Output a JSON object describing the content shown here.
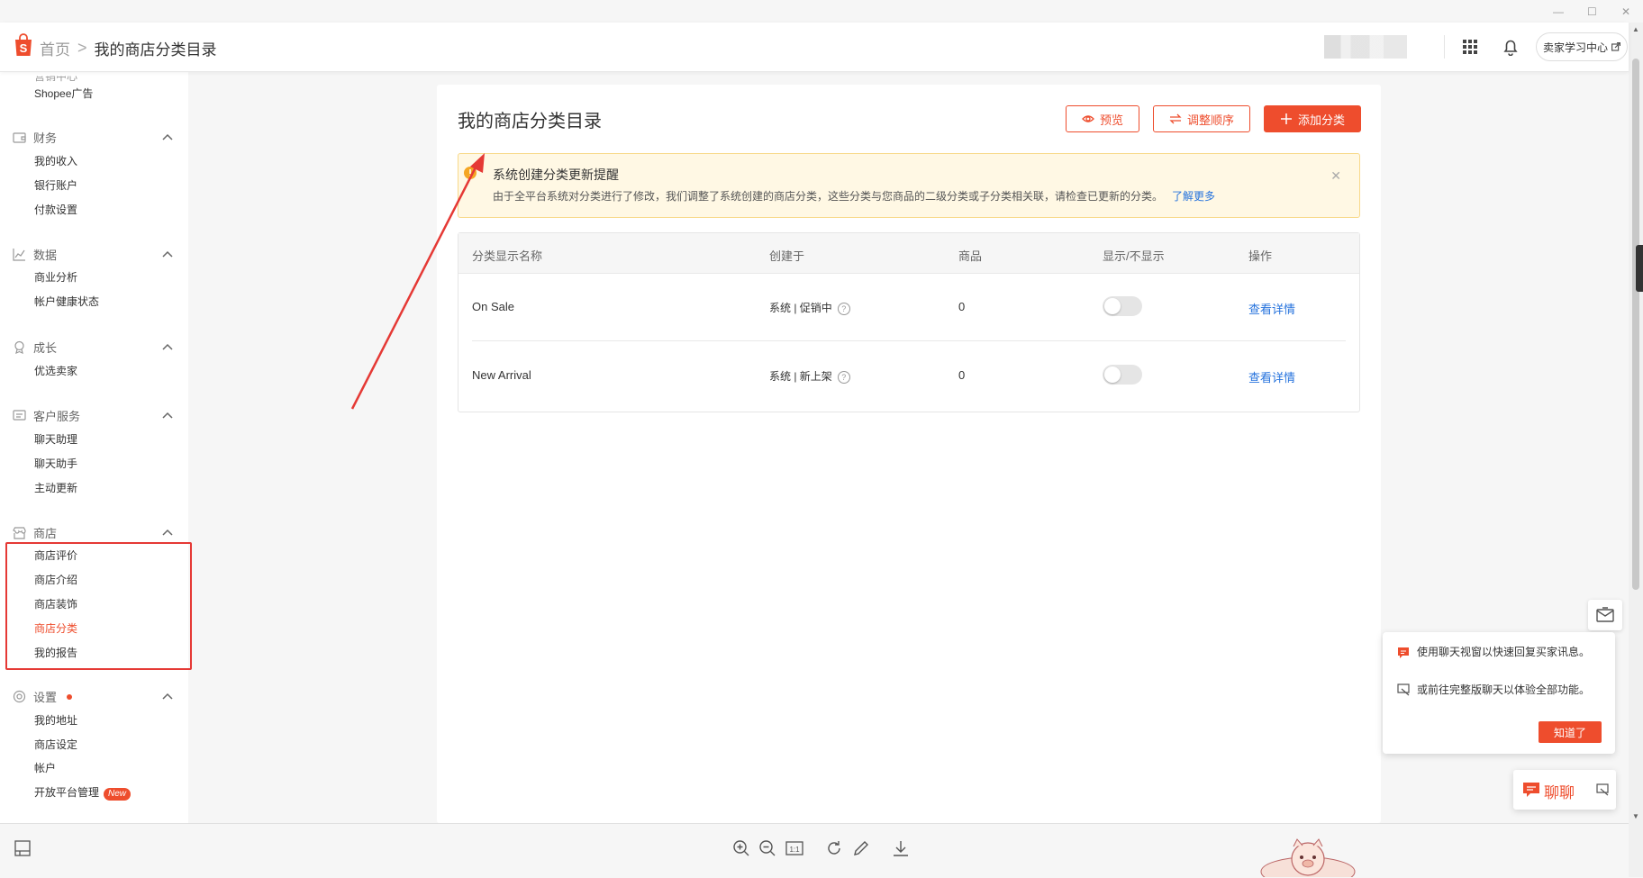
{
  "header": {
    "home_label": "首页",
    "separator": ">",
    "current_label": "我的商店分类目录",
    "learning_center": "卖家学习中心"
  },
  "window": {
    "minimize": "—",
    "maximize": "☐",
    "close": "✕"
  },
  "sidebar": {
    "partial_top": "营销中心",
    "ads": "Shopee广告",
    "sections": [
      {
        "title": "财务",
        "items": [
          "我的收入",
          "银行账户",
          "付款设置"
        ]
      },
      {
        "title": "数据",
        "items": [
          "商业分析",
          "帐户健康状态"
        ]
      },
      {
        "title": "成长",
        "items": [
          "优选卖家"
        ]
      },
      {
        "title": "客户服务",
        "items": [
          "聊天助理",
          "聊天助手",
          "主动更新"
        ]
      },
      {
        "title": "商店",
        "items": [
          "商店评价",
          "商店介绍",
          "商店装饰",
          "商店分类",
          "我的报告"
        ]
      },
      {
        "title": "设置",
        "items": [
          "我的地址",
          "商店设定",
          "帐户",
          "开放平台管理"
        ]
      }
    ],
    "new_badge": "New",
    "active_item": "商店分类"
  },
  "main": {
    "title": "我的商店分类目录",
    "buttons": {
      "preview": "预览",
      "reorder": "调整顺序",
      "add": "添加分类"
    },
    "notice": {
      "title": "系统创建分类更新提醒",
      "body": "由于全平台系统对分类进行了修改，我们调整了系统创建的商店分类，这些分类与您商品的二级分类或子分类相关联，请检查已更新的分类。",
      "link": "了解更多",
      "close": "✕"
    },
    "table": {
      "headers": [
        "分类显示名称",
        "创建于",
        "商品",
        "显示/不显示",
        "操作"
      ],
      "rows": [
        {
          "name": "On Sale",
          "created": "系统 | 促销中",
          "products": "0",
          "visible": false,
          "action": "查看详情"
        },
        {
          "name": "New Arrival",
          "created": "系统 | 新上架",
          "products": "0",
          "visible": false,
          "action": "查看详情"
        }
      ],
      "help_mark": "?"
    }
  },
  "chat": {
    "popup_line1": "使用聊天视窗以快速回复买家讯息。",
    "popup_line2": "或前往完整版聊天以体验全部功能。",
    "got_it": "知道了",
    "chat_label": "聊聊"
  },
  "icons": [
    "shopee-logo-icon",
    "grid-icon",
    "bell-icon",
    "eye-icon",
    "reorder-icon",
    "plus-icon",
    "warning-icon",
    "close-icon",
    "help-icon",
    "zoom-in-icon",
    "zoom-out-icon",
    "actual-size-icon",
    "rotate-icon",
    "edit-icon",
    "download-icon",
    "chat-icon",
    "message-icon"
  ],
  "colors": {
    "brand": "#ee4d2d",
    "link": "#2673dd",
    "notice_bg": "#fff8e4",
    "annotation_red": "#e53935"
  }
}
